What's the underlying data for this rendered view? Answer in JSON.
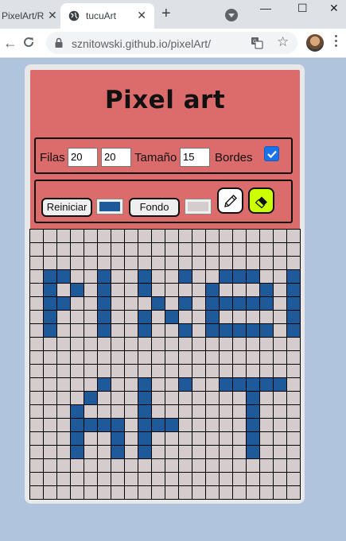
{
  "browser": {
    "tabs": [
      {
        "title": "PixelArt/R",
        "active": false
      },
      {
        "title": "tucuArt",
        "active": true
      }
    ],
    "new_tab": "+",
    "close_glyph": "✕",
    "url": "sznitowski.github.io/pixelArt/",
    "window_controls": {
      "minimize": "—",
      "maximize": "☐",
      "close": "✕"
    },
    "icons": [
      "back-icon",
      "reload-icon",
      "lock-icon",
      "translate-icon",
      "star-icon",
      "globe-icon"
    ]
  },
  "app": {
    "title": "Pixel art",
    "controls": {
      "rows_label": "Filas",
      "rows_value": "20",
      "cols_value": "20",
      "size_label": "Tamaño",
      "size_value": "15",
      "borders_label": "Bordes",
      "borders_checked": true
    },
    "actions": {
      "reset_label": "Reiniciar",
      "background_label": "Fondo",
      "paint_color": "#1e5a9a",
      "background_color": "#d5cdcd",
      "pencil_bg": "#ffffff",
      "eraser_bg": "#ccff00"
    },
    "grid": {
      "rows": 20,
      "cols": 20,
      "off_color": "#d5cdcd",
      "on_color": "#1e5a9a",
      "pixels": [
        "00000000000000000000",
        "00000000000000000000",
        "00000000000000000000",
        "01100100100100111001",
        "01010100100001000101",
        "01100100010101111101",
        "01000100101001000001",
        "01000100100101111101",
        "00000000000000000000",
        "00000000000000000000",
        "00000000000000000000",
        "00000100100100111110",
        "00001000100000001000",
        "00010000100000001000",
        "00011110111000001000",
        "00010010100000001000",
        "00010010100000001000",
        "00000000000000000000",
        "00000000000000000000",
        "00000000000000000000"
      ]
    }
  }
}
